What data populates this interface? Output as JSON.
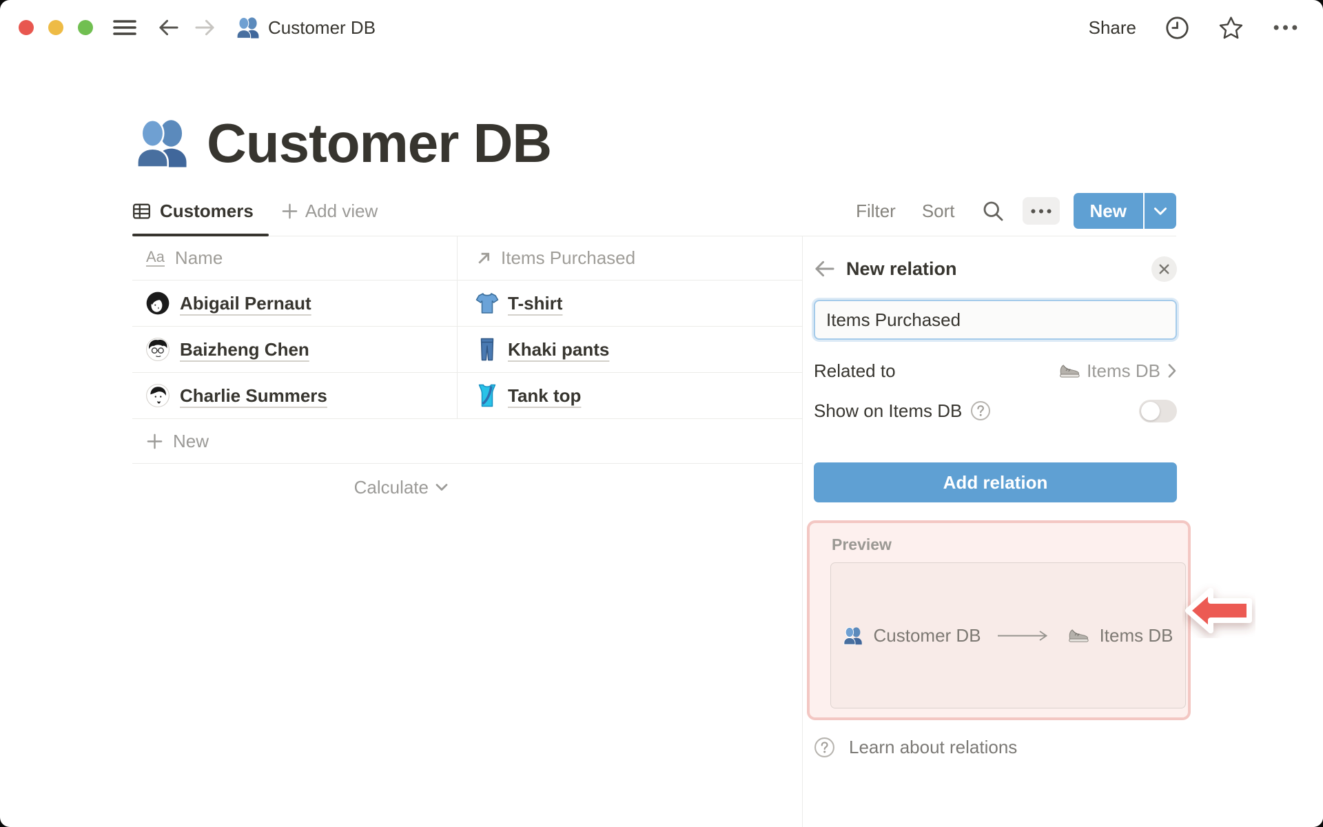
{
  "colors": {
    "accent_blue": "#5fa0d3",
    "preview_pink_bg": "#fdf0ee",
    "preview_pink_border": "#f3c7c3",
    "annotation_red": "#ec5a53",
    "traffic_red": "#e8574f",
    "traffic_yellow": "#eebb45",
    "traffic_green": "#71bf51"
  },
  "titlebar": {
    "menu_icon": "hamburger-icon",
    "back_icon": "back-arrow-icon",
    "forward_icon": "forward-arrow-icon",
    "doc_icon": "people-icon",
    "title": "Customer DB",
    "share_label": "Share",
    "clock_icon": "clock-icon",
    "star_icon": "star-icon",
    "more_icon": "dots-icon"
  },
  "page": {
    "icon": "people-icon",
    "title": "Customer DB"
  },
  "toolbar": {
    "tab_icon": "table-view-icon",
    "tab_label": "Customers",
    "add_view_icon": "plus-icon",
    "add_view_label": "Add view",
    "filter_label": "Filter",
    "sort_label": "Sort",
    "search_icon": "search-icon",
    "more_icon": "dots-icon",
    "new_label": "New",
    "new_chevron_icon": "chevron-down-icon"
  },
  "table": {
    "columns": [
      {
        "icon": "text-type-icon",
        "label": "Name"
      },
      {
        "icon": "arrow-up-right-icon",
        "label": "Items Purchased"
      }
    ],
    "rows": [
      {
        "avatar": "avatar-abigail",
        "name": "Abigail Pernaut",
        "item_icon": "tshirt-icon",
        "item": "T-shirt"
      },
      {
        "avatar": "avatar-baizheng",
        "name": "Baizheng Chen",
        "item_icon": "jeans-icon",
        "item": "Khaki pants"
      },
      {
        "avatar": "avatar-charlie",
        "name": "Charlie Summers",
        "item_icon": "tanktop-icon",
        "item": "Tank top"
      }
    ],
    "new_row_icon": "plus-icon",
    "new_row_label": "New",
    "calculate_label": "Calculate",
    "calculate_icon": "chevron-down-icon"
  },
  "panel": {
    "back_icon": "back-arrow-icon",
    "title": "New relation",
    "close_icon": "close-icon",
    "name_value": "Items Purchased",
    "related_label": "Related to",
    "related_icon": "sneaker-icon",
    "related_value": "Items DB",
    "related_chevron_icon": "chevron-right-icon",
    "show_label": "Show on Items DB",
    "help_icon": "question-icon",
    "toggle_state": "off",
    "add_label": "Add relation",
    "preview": {
      "label": "Preview",
      "source_icon": "people-icon",
      "source": "Customer DB",
      "arrow_icon": "long-arrow-icon",
      "target_icon": "sneaker-icon",
      "target": "Items DB"
    },
    "learn_icon": "question-icon",
    "learn_label": "Learn about relations"
  },
  "annotation": {
    "icon": "red-arrow-icon"
  }
}
